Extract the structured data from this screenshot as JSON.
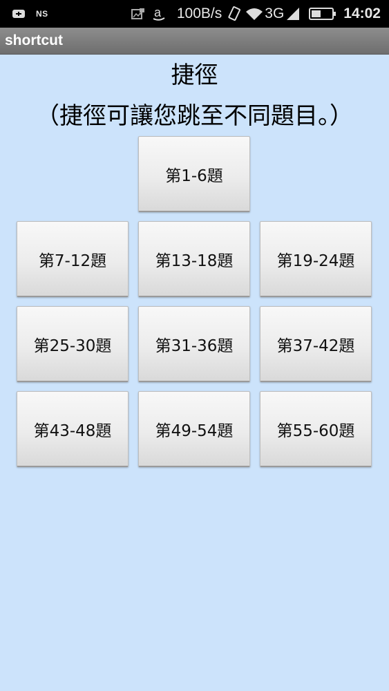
{
  "status_bar": {
    "notification_label": "NS",
    "speed": "100B/s",
    "network": "3G",
    "time": "14:02",
    "icons": [
      "usb-icon",
      "ns-notification",
      "image-icon",
      "amazon-icon",
      "vibrate-icon",
      "wifi-icon",
      "signal-icon",
      "battery-icon"
    ]
  },
  "titlebar": {
    "title": "shortcut"
  },
  "content": {
    "heading": "捷徑",
    "subheading": "（捷徑可讓您跳至不同題目。）",
    "buttons": [
      "第1-6題",
      "第7-12題",
      "第13-18題",
      "第19-24題",
      "第25-30題",
      "第31-36題",
      "第37-42題",
      "第43-48題",
      "第49-54題",
      "第55-60題"
    ]
  },
  "colors": {
    "background": "#cce3fb",
    "titlebar": "#7d7d7d",
    "statusbar": "#000000",
    "button": "#ececec"
  }
}
